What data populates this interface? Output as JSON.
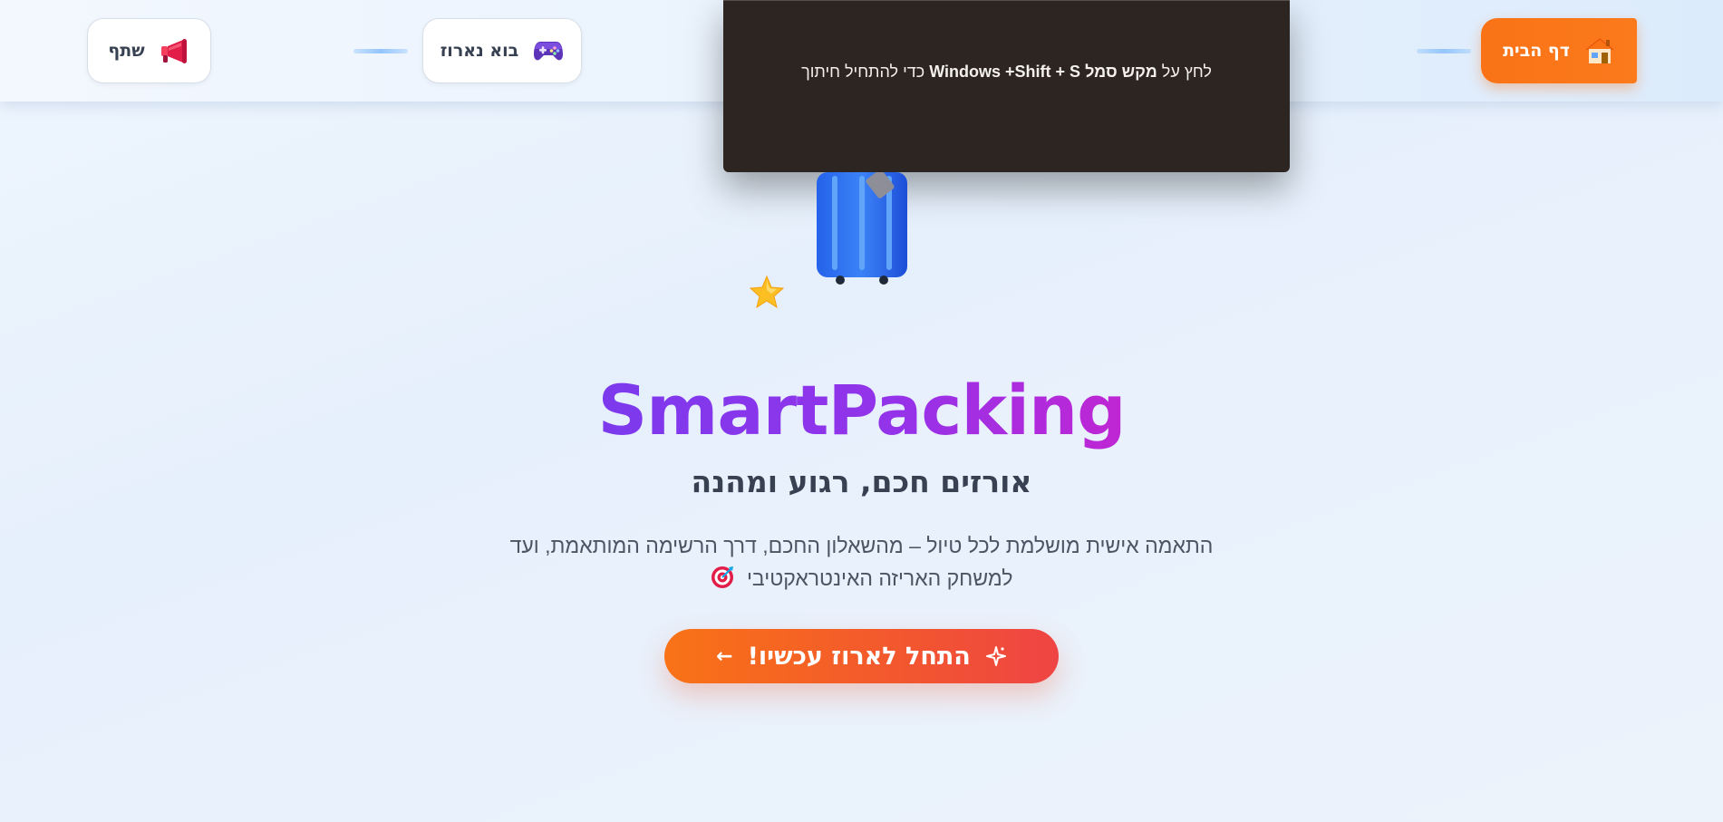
{
  "nav": {
    "share_label": "שתף",
    "share_icon": "megaphone-icon",
    "game_label": "בוא נארוז",
    "game_icon": "gamepad-icon",
    "home_label": "דף הבית",
    "home_icon": "house-icon"
  },
  "snipping_overlay": {
    "text_1": "לחץ על ",
    "key_name": "מקש סמל",
    "text_2": " Windows +Shift + S",
    "text_3": " כדי להתחיל חיתוך"
  },
  "hero": {
    "illustration": "suitcase-icon",
    "sparkle": "star-icon",
    "brand": "SmartPacking",
    "subtitle": "אורזים חכם, רגוע ומהנה",
    "description_line1": "התאמה אישית מושלמת לכל טיול – מהשאלון החכם, דרך הרשימה המותאמת, ועד",
    "description_line2": "למשחק האריזה האינטראקטיבי",
    "description_icon": "target-icon",
    "cta_label": "התחל לארוז עכשיו!",
    "cta_arrow": "←",
    "cta_icon": "sparkle-icon"
  },
  "colors": {
    "accent_orange": "#f97316",
    "brand_purple": "#7c3aed",
    "brand_magenta": "#c026d3",
    "cta_red": "#ef4444"
  }
}
